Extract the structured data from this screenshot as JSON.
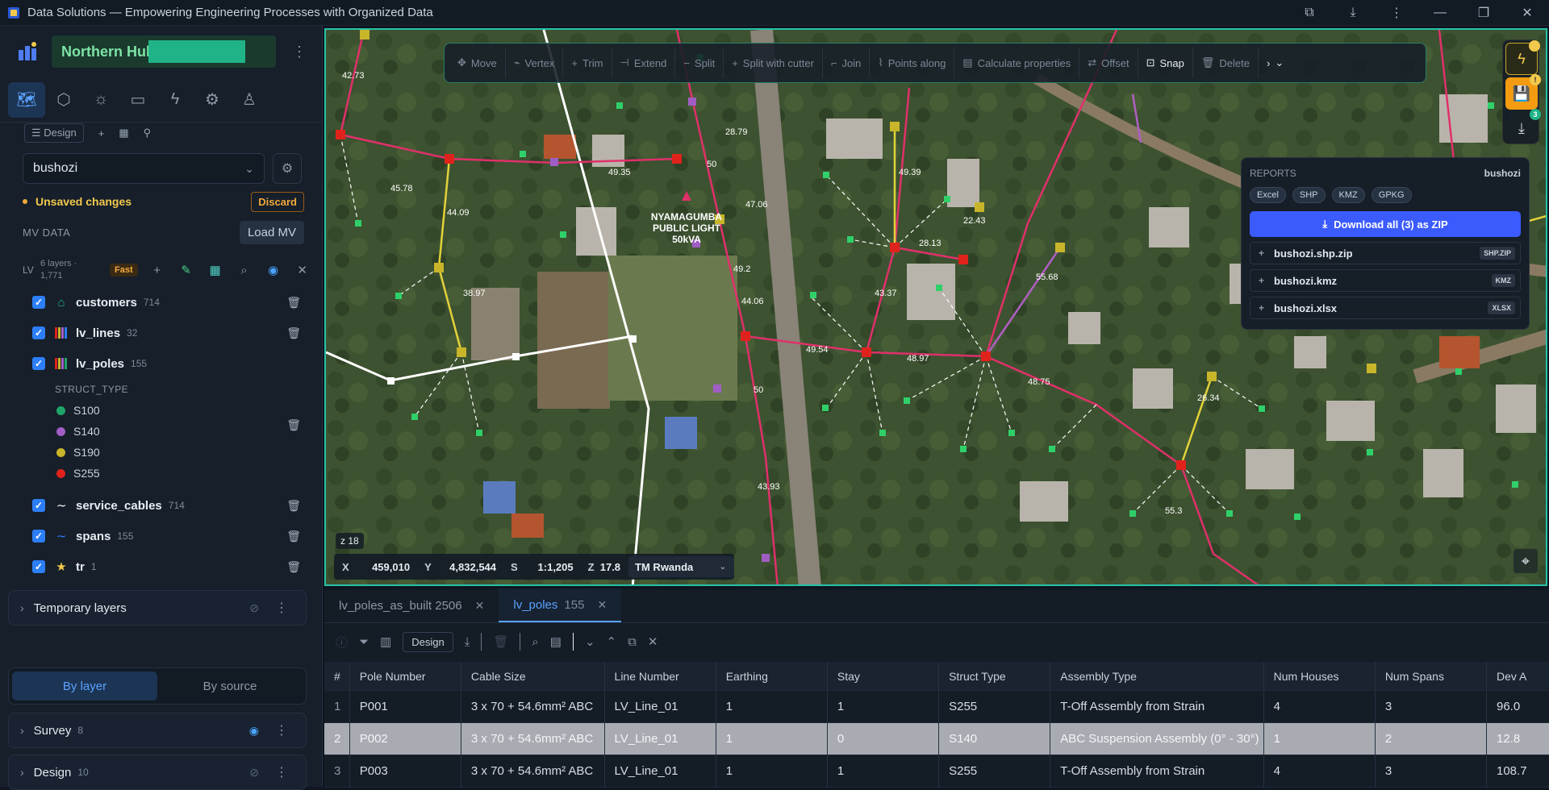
{
  "window": {
    "title": "Data Solutions — Empowering Engineering Processes with Organized Data"
  },
  "sidebar": {
    "hub_name": "Northern Hub",
    "design_label": "Design",
    "project_select": "bushozi",
    "unsaved_text": "Unsaved changes",
    "discard_label": "Discard",
    "mv_label": "MV DATA",
    "load_mv_label": "Load MV",
    "lv": {
      "tag": "LV",
      "layers_text": "6 layers ·",
      "count_text": "1,771",
      "speed_badge": "Fast"
    },
    "layers": [
      {
        "name": "customers",
        "count": "714"
      },
      {
        "name": "lv_lines",
        "count": "32"
      },
      {
        "name": "lv_poles",
        "count": "155"
      },
      {
        "name": "service_cables",
        "count": "714"
      },
      {
        "name": "spans",
        "count": "155"
      },
      {
        "name": "tr",
        "count": "1"
      }
    ],
    "struct_type_heading": "STRUCT_TYPE",
    "struct_types": [
      {
        "label": "S100",
        "color": "#1fa56a"
      },
      {
        "label": "S140",
        "color": "#a05ec4"
      },
      {
        "label": "S190",
        "color": "#c9b52a"
      },
      {
        "label": "S255",
        "color": "#e0221c"
      }
    ],
    "temp_layers": "Temporary layers",
    "toggle": {
      "by_layer": "By layer",
      "by_source": "By source"
    },
    "groups": [
      {
        "name": "Survey",
        "count": "8"
      },
      {
        "name": "Design",
        "count": "10"
      }
    ]
  },
  "map": {
    "tools": [
      "Move",
      "Vertex",
      "Trim",
      "Extend",
      "Split",
      "Split with cutter",
      "Join",
      "Points along",
      "Calculate properties",
      "Offset",
      "Snap",
      "Delete"
    ],
    "active_tool": "Snap",
    "rail_badges": {
      "save": "!",
      "download": "3"
    },
    "reports": {
      "heading": "REPORTS",
      "project": "bushozi",
      "formats": [
        "Excel",
        "SHP",
        "KMZ",
        "GPKG"
      ],
      "download_all": "Download all (3) as ZIP",
      "files": [
        {
          "name": "bushozi.shp.zip",
          "tag": "SHP.ZIP"
        },
        {
          "name": "bushozi.kmz",
          "tag": "KMZ"
        },
        {
          "name": "bushozi.xlsx",
          "tag": "XLSX"
        }
      ]
    },
    "zoom_label": "z 18",
    "coords": {
      "x_label": "X",
      "x": "459,010",
      "y_label": "Y",
      "y": "4,832,544",
      "s_label": "S",
      "s": "1:1,205",
      "z_label": "Z",
      "z": "17.8",
      "crs": "TM Rwanda"
    },
    "labels": {
      "tr_name": "NYAMAGUMBA",
      "tr_line2": "PUBLIC LIGHT",
      "tr_kva": "50kVA"
    },
    "span_labels": [
      "42.73",
      "45.78",
      "49.35",
      "44.09",
      "38.97",
      "47.06",
      "28.79",
      "50",
      "49.2",
      "44.06",
      "49.54",
      "48.97",
      "43.37",
      "49.39",
      "28.13",
      "22.43",
      "48.75",
      "55.68",
      "43.93",
      "50",
      "55.3",
      "26.34"
    ]
  },
  "bottom": {
    "tabs": [
      {
        "label": "lv_poles_as_built 2506",
        "count": ""
      },
      {
        "label": "lv_poles",
        "count": "155"
      }
    ],
    "design_chip": "Design",
    "columns": [
      "#",
      "Pole Number",
      "Cable Size",
      "Line Number",
      "Earthing",
      "Stay",
      "Struct Type",
      "Assembly Type",
      "Num Houses",
      "Num Spans",
      "Dev A"
    ],
    "rows": [
      [
        "1",
        "P001",
        "3 x 70 + 54.6mm² ABC",
        "LV_Line_01",
        "1",
        "1",
        "S255",
        "T-Off Assembly from Strain",
        "4",
        "3",
        "96.0"
      ],
      [
        "2",
        "P002",
        "3 x 70 + 54.6mm² ABC",
        "LV_Line_01",
        "1",
        "0",
        "S140",
        "ABC Suspension Assembly (0° - 30°)",
        "1",
        "2",
        "12.8"
      ],
      [
        "3",
        "P003",
        "3 x 70 + 54.6mm² ABC",
        "LV_Line_01",
        "1",
        "1",
        "S255",
        "T-Off Assembly from Strain",
        "4",
        "3",
        "108.7"
      ]
    ]
  }
}
